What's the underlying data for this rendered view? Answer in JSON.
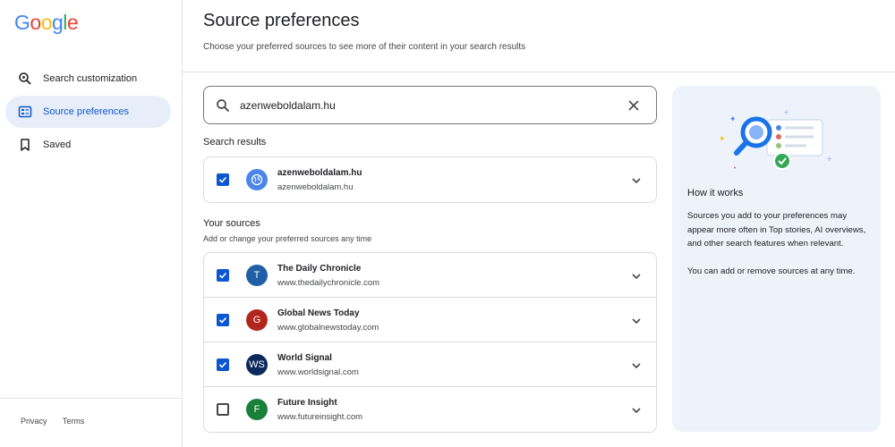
{
  "brand": {
    "logo_letters": [
      {
        "ch": "G",
        "color": "#4285F4"
      },
      {
        "ch": "o",
        "color": "#EA4335"
      },
      {
        "ch": "o",
        "color": "#FBBC05"
      },
      {
        "ch": "g",
        "color": "#4285F4"
      },
      {
        "ch": "l",
        "color": "#34A853"
      },
      {
        "ch": "e",
        "color": "#EA4335"
      }
    ]
  },
  "sidebar": {
    "items": [
      {
        "label": "Search customization",
        "icon": "search-settings-icon",
        "active": false
      },
      {
        "label": "Source preferences",
        "icon": "source-list-icon",
        "active": true
      },
      {
        "label": "Saved",
        "icon": "bookmark-icon",
        "active": false
      }
    ],
    "footer": {
      "privacy": "Privacy",
      "terms": "Terms"
    }
  },
  "header": {
    "title": "Source preferences",
    "subtitle": "Choose your preferred sources to see more of their content in your search results"
  },
  "search": {
    "value": "azenweboldalam.hu"
  },
  "search_results": {
    "heading": "Search results",
    "items": [
      {
        "name": "azenweboldalam.hu",
        "url": "azenweboldalam.hu",
        "checked": true,
        "avatar": "globe-icon",
        "avatar_color": "#4a86e8"
      }
    ]
  },
  "your_sources": {
    "heading": "Your sources",
    "subheading": "Add or change your preferred sources any time",
    "items": [
      {
        "name": "The Daily Chronicle",
        "url": "www.thedailychronicle.com",
        "checked": true,
        "initials": "T",
        "avatar_color": "#1f5fa8"
      },
      {
        "name": "Global News Today",
        "url": "www.globalnewstoday.com",
        "checked": true,
        "initials": "G",
        "avatar_color": "#b3261e"
      },
      {
        "name": "World Signal",
        "url": "www.worldsignal.com",
        "checked": true,
        "initials": "WS",
        "avatar_color": "#0b2a5b"
      },
      {
        "name": "Future Insight",
        "url": "www.futureinsight.com",
        "checked": false,
        "initials": "F",
        "avatar_color": "#188038"
      }
    ]
  },
  "how_it_works": {
    "title": "How it works",
    "paragraph1": "Sources you add to your preferences may appear more often in Top stories, AI overviews, and other search features when relevant.",
    "paragraph2": "You can add or remove sources at any time."
  },
  "colors": {
    "accent": "#0b57d0",
    "active_nav_bg": "#e8eef9",
    "panel_bg": "#eef3fb"
  }
}
